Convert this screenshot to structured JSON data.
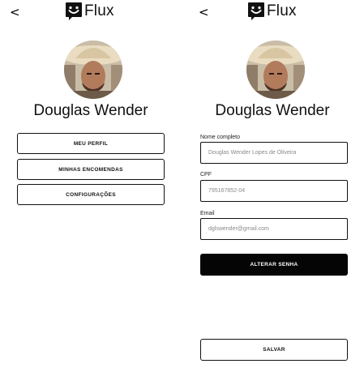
{
  "brand": {
    "name": "Flux",
    "logo_icon": "smiley-chat-logo-icon"
  },
  "profile_menu": {
    "back_icon": "chevron-left-icon",
    "back_glyph": "<",
    "user_name": "Douglas Wender",
    "menu": [
      {
        "label": "MEU PERFIL"
      },
      {
        "label": "MINHAS ENCOMENDAS"
      },
      {
        "label": "CONFIGURAÇÕES"
      }
    ]
  },
  "profile_edit": {
    "back_icon": "chevron-left-icon",
    "back_glyph": "<",
    "user_name": "Douglas Wender",
    "fields": [
      {
        "label": "Nome completo",
        "value": "Douglas Wender Lopes de Oliveira"
      },
      {
        "label": "CPF",
        "value": "795167852-04"
      },
      {
        "label": "Email",
        "value": "dglswender@gmail.com"
      }
    ],
    "change_password_label": "ALTERAR SENHA",
    "save_label": "SALVAR"
  },
  "colors": {
    "primary": "#050505",
    "border": "#111111",
    "field_text": "#8a8a8a",
    "background": "#ffffff"
  }
}
